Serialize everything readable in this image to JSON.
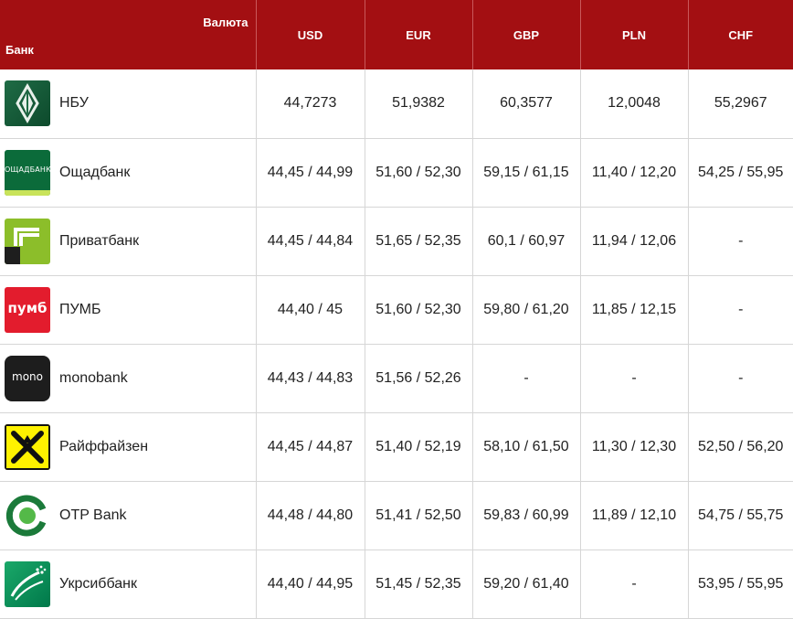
{
  "header": {
    "corner_top": "Валюта",
    "corner_bottom": "Банк",
    "currencies": [
      "USD",
      "EUR",
      "GBP",
      "PLN",
      "CHF"
    ]
  },
  "colors": {
    "header_bg": "#a30f12",
    "header_text": "#ffffff",
    "grid_line": "#d6d6d6"
  },
  "banks": [
    {
      "name": "НБУ",
      "logo": "nbu-logo",
      "rates": [
        "44,7273",
        "51,9382",
        "60,3577",
        "12,0048",
        "55,2967"
      ]
    },
    {
      "name": "Ощадбанк",
      "logo": "oschadbank-logo",
      "logo_text": "ОЩАДБАНК",
      "rates": [
        "44,45 / 44,99",
        "51,60 / 52,30",
        "59,15 / 61,15",
        "11,40 / 12,20",
        "54,25 / 55,95"
      ]
    },
    {
      "name": "Приватбанк",
      "logo": "privatbank-logo",
      "rates": [
        "44,45 / 44,84",
        "51,65 / 52,35",
        "60,1 / 60,97",
        "11,94 / 12,06",
        "-"
      ]
    },
    {
      "name": "ПУМБ",
      "logo": "pumb-logo",
      "logo_text": "пумб",
      "rates": [
        "44,40 / 45",
        "51,60 / 52,30",
        "59,80 / 61,20",
        "11,85 / 12,15",
        "-"
      ]
    },
    {
      "name": "monobank",
      "logo": "monobank-logo",
      "logo_text": "mono",
      "rates": [
        "44,43 / 44,83",
        "51,56 / 52,26",
        "-",
        "-",
        "-"
      ]
    },
    {
      "name": "Райффайзен",
      "logo": "raiffeisen-logo",
      "rates": [
        "44,45 / 44,87",
        "51,40 / 52,19",
        "58,10 / 61,50",
        "11,30 / 12,30",
        "52,50 / 56,20"
      ]
    },
    {
      "name": "OTP Bank",
      "logo": "otp-bank-logo",
      "rates": [
        "44,48 / 44,80",
        "51,41 / 52,50",
        "59,83 / 60,99",
        "11,89 / 12,10",
        "54,75 / 55,75"
      ]
    },
    {
      "name": "Укрсиббанк",
      "logo": "ukrsibbank-logo",
      "rates": [
        "44,40 / 44,95",
        "51,45 / 52,35",
        "59,20 / 61,40",
        "-",
        "53,95 / 55,95"
      ]
    }
  ]
}
